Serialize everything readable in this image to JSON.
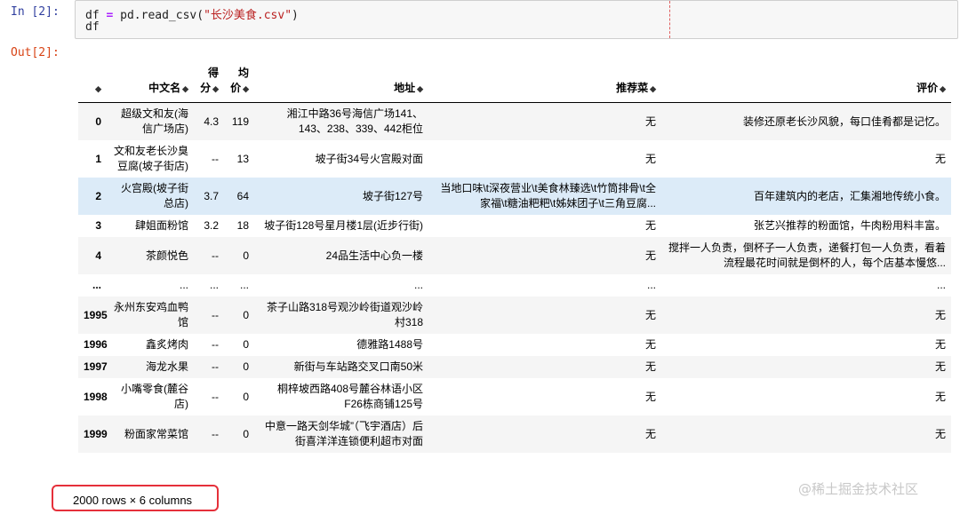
{
  "input_cell": {
    "prompt": "In [2]:",
    "line1": {
      "var": "df",
      "op": "=",
      "call": " pd.read_csv(",
      "arg": "\"长沙美食.csv\"",
      "close": ")"
    },
    "line2": "df"
  },
  "output_cell": {
    "prompt": "Out[2]:"
  },
  "table": {
    "columns": [
      "中文名",
      "得分",
      "均价",
      "地址",
      "推荐菜",
      "评价"
    ],
    "sort_icon": "sort-icon",
    "rows": [
      {
        "index": "0",
        "name": "超级文和友(海信广场店)",
        "score": "4.3",
        "price": "119",
        "address": "湘江中路36号海信广场141、143、238、339、442柜位",
        "dishes": "无",
        "review": "装修还原老长沙风貌，每口佳肴都是记忆。"
      },
      {
        "index": "1",
        "name": "文和友老长沙臭豆腐(坡子街店)",
        "score": "--",
        "price": "13",
        "address": "坡子街34号火宫殿对面",
        "dishes": "无",
        "review": "无"
      },
      {
        "index": "2",
        "name": "火宫殿(坡子街总店)",
        "score": "3.7",
        "price": "64",
        "address": "坡子街127号",
        "dishes": "当地口味\\t深夜营业\\t美食林臻选\\t竹筒排骨\\t全家福\\t糖油粑粑\\t姊妹团子\\t三角豆腐...",
        "review": "百年建筑内的老店，汇集湘地传统小食。"
      },
      {
        "index": "3",
        "name": "肆姐面粉馆",
        "score": "3.2",
        "price": "18",
        "address": "坡子街128号星月楼1层(近步行街)",
        "dishes": "无",
        "review": "张艺兴推荐的粉面馆，牛肉粉用料丰富。"
      },
      {
        "index": "4",
        "name": "茶颜悦色",
        "score": "--",
        "price": "0",
        "address": "24品生活中心负一楼",
        "dishes": "无",
        "review": "搅拌一人负责，倒杯子一人负责，递餐打包一人负责，看着流程最花时间就是倒杯的人，每个店基本慢悠..."
      },
      {
        "index": "...",
        "name": "...",
        "score": "...",
        "price": "...",
        "address": "...",
        "dishes": "...",
        "review": "..."
      },
      {
        "index": "1995",
        "name": "永州东安鸡血鸭馆",
        "score": "--",
        "price": "0",
        "address": "茶子山路318号观沙岭街道观沙岭村318",
        "dishes": "无",
        "review": "无"
      },
      {
        "index": "1996",
        "name": "鑫炙烤肉",
        "score": "--",
        "price": "0",
        "address": "德雅路1488号",
        "dishes": "无",
        "review": "无"
      },
      {
        "index": "1997",
        "name": "海龙水果",
        "score": "--",
        "price": "0",
        "address": "新街与车站路交叉口南50米",
        "dishes": "无",
        "review": "无"
      },
      {
        "index": "1998",
        "name": "小嘴零食(麓谷店)",
        "score": "--",
        "price": "0",
        "address": "桐梓坡西路408号麓谷林语小区F26栋商铺125号",
        "dishes": "无",
        "review": "无"
      },
      {
        "index": "1999",
        "name": "粉面家常菜馆",
        "score": "--",
        "price": "0",
        "address": "中意一路天剑华城”（飞宇酒店）后街喜洋洋连锁便利超市对面",
        "dishes": "无",
        "review": "无"
      }
    ],
    "highlighted_row": "2"
  },
  "footer": {
    "shape_text": "2000 rows × 6 columns",
    "highlight_color": "#e5303a"
  },
  "watermark": "@稀土掘金技术社区"
}
